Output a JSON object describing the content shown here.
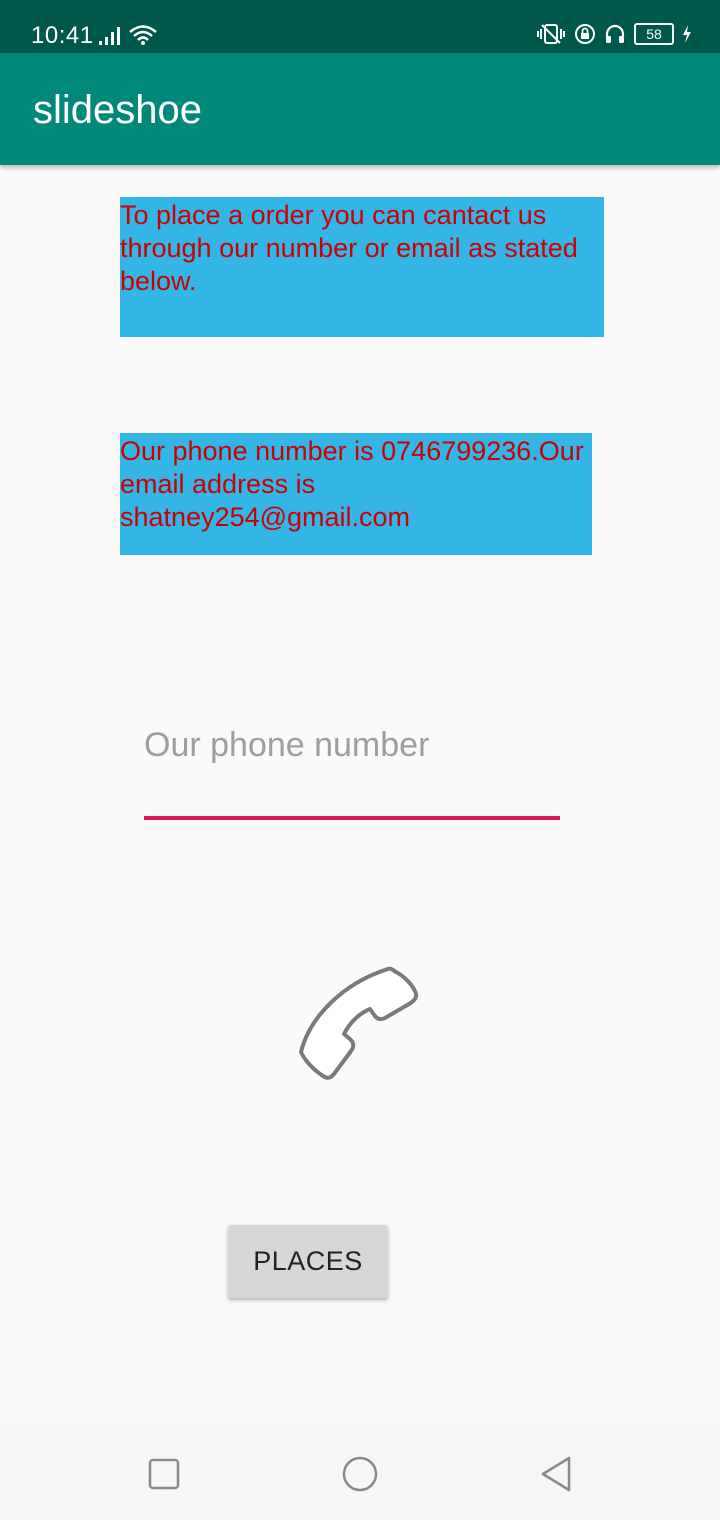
{
  "status_bar": {
    "time": "10:41",
    "battery_level": "58",
    "left_icons": [
      "signal-icon",
      "wifi-icon"
    ],
    "right_icons": [
      "vibrate-icon",
      "rotation-lock-icon",
      "headphones-icon",
      "battery-icon",
      "charging-icon"
    ]
  },
  "app_bar": {
    "title": "slideshoe"
  },
  "content": {
    "order_info": "To place a order you can cantact us through our number or email as stated below.",
    "contact_info": "Our phone number is 0746799236.Our email address is shatney254@gmail.com",
    "phone_input": {
      "value": "",
      "placeholder": "Our phone number"
    },
    "call_icon": "phone-call-icon",
    "places_button": "PLACES"
  },
  "nav_bar": {
    "buttons": [
      "recents-button",
      "home-button",
      "back-button"
    ]
  },
  "colors": {
    "status_bar": "#00574b",
    "app_bar": "#00897b",
    "info_box_bg": "#33b5e5",
    "info_text": "#cc0000",
    "input_underline": "#d81b60",
    "button_bg": "#d6d7d7"
  }
}
